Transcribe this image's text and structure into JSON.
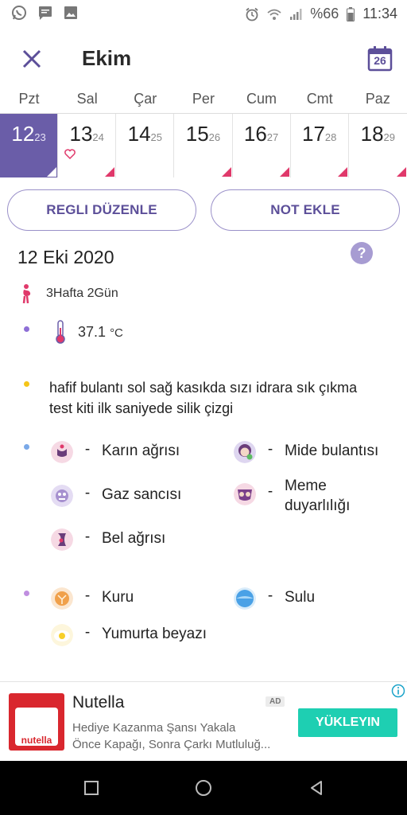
{
  "status_bar": {
    "battery": "%66",
    "time": "11:34"
  },
  "header": {
    "title": "Ekim",
    "calendar_day": "26"
  },
  "week": {
    "weekdays": [
      "Pzt",
      "Sal",
      "Çar",
      "Per",
      "Cum",
      "Cmt",
      "Paz"
    ],
    "days": [
      {
        "num": "12",
        "sub": "23"
      },
      {
        "num": "13",
        "sub": "24"
      },
      {
        "num": "14",
        "sub": "25"
      },
      {
        "num": "15",
        "sub": "26"
      },
      {
        "num": "16",
        "sub": "27"
      },
      {
        "num": "17",
        "sub": "28"
      },
      {
        "num": "18",
        "sub": "29"
      }
    ]
  },
  "actions": {
    "edit_period": "REGLI DÜZENLE",
    "add_note": "NOT EKLE"
  },
  "detail": {
    "date": "12 Eki 2020",
    "help": "?",
    "pregnancy": "3Hafta 2Gün",
    "temperature": "37.1",
    "temperature_unit": "°C",
    "note": "hafif bulantı sol sağ kasıkda sızı idrara sık çıkma test kiti ilk saniyede silik çizgi"
  },
  "symptoms": {
    "dash": "-",
    "cramps": "Karın ağrısı",
    "nausea": "Mide bulantısı",
    "gas": "Gaz sancısı",
    "breast": "Meme duyarlılığı",
    "backache": "Bel ağrısı"
  },
  "discharge": {
    "dry": "Kuru",
    "wet": "Sulu",
    "egg_white": "Yumurta beyazı"
  },
  "ad": {
    "brand_text": "nutella",
    "title": "Nutella",
    "badge": "AD",
    "line1": "Hediye Kazanma Şansı Yakala",
    "line2": "Önce Kapağı, Sonra Çarkı Mutluluğ...",
    "cta": "YÜKLEYIN"
  },
  "colors": {
    "accent": "#6a5da8",
    "pink": "#e0396b",
    "cta": "#1ecfb2"
  }
}
